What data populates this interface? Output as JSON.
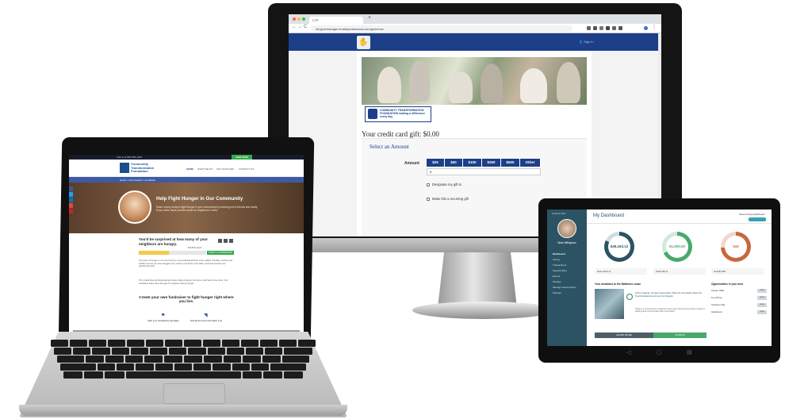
{
  "monitor": {
    "browser": {
      "tab_title": "CTF",
      "tab_plus": "+",
      "url": "ctf.givemanager.charityondemand.com/give/now",
      "back": "←",
      "forward": "→",
      "reload": "C"
    },
    "site": {
      "sign_in": "Sign In",
      "logo_text": "COMMUNITY TRANSFORMATION FOUNDATION making a difference every day",
      "gift_label": "Your credit card gift: $0.00",
      "select_amount": "Select an Amount",
      "amount_label": "Amount",
      "amounts": [
        "$25",
        "$50",
        "$100",
        "$250",
        "$500",
        "Other"
      ],
      "amount_input": "$",
      "designate": "Designate my gift to",
      "recurring": "Make this a recurring gift"
    }
  },
  "laptop": {
    "phone": "Call us at 800-555-1234",
    "donate_now": "GIVE NOW",
    "org_name": "Community Transformation Foundation",
    "nav": [
      "HOME",
      "WHAT WE DO",
      "GET INVOLVED",
      "CONTACT US"
    ],
    "breadcrumb": "Home > Get Involved > Fundraise",
    "hero_title": "Help Fight Hunger in Our Community",
    "hero_sub": "Raise money today to fight hunger in your community by reaching out to friends and family. Every dollar helps provide meals for neighbors in need.",
    "surprised": "You'd be surprised at how many of your neighbors are hungry.",
    "progress_fraction": 0.45,
    "progress_label": "$19,500 raised",
    "start_btn": "START A FUNDRAISER",
    "para1": "The issue of hunger in our community is more widespread than many realize. Families, seniors and children across our area struggle every week to put food on the table, and local pantries see growing demand.",
    "para2": "The United Way and local partners have made progress, but there is still work to be done. Your fundraiser helps close the gap for neighbors facing hunger.",
    "create": "Create your own fundraiser to fight hunger right where you live.",
    "step1": "Start your fundraising campaign",
    "step2": "Spread the word and watch it go"
  },
  "tablet": {
    "brand": "Product-WW",
    "user_name": "Brian Billingham",
    "side_items": [
      "Dashboard",
      "Giving",
      "Transactions",
      "Opportunities",
      "Events",
      "Pledges",
      "Manage Subscriptions",
      "Settings"
    ],
    "title": "My Dashboard",
    "toggle_label": "Show Giving Dashboard",
    "rings": [
      {
        "value": "$49,163.12",
        "color": "#2c5364"
      },
      {
        "value": "$1,500.00",
        "color": "#4aa86b"
      },
      {
        "value": "432",
        "color": "#c9673f"
      }
    ],
    "stat_boxes": [
      "Gave Since $",
      "Total Gifts $",
      "Goal $1,000"
    ],
    "news_section": "Your donations to the Baltimore cause",
    "news_title": "Action Ageing: Hunger Association Reports Increasing Need for Food Assistance Across Our Region",
    "news_body": "Today our local partners released a new report showing how donor support is helping feed more families than ever before.",
    "learn_more": "LEARN MORE",
    "donate": "DONATE",
    "table_title": "Opportunities in your area",
    "table_rows": [
      {
        "label": "Hunger Walk",
        "btn": "VIEW"
      },
      {
        "label": "Food Drive",
        "btn": "VIEW"
      },
      {
        "label": "Volunteer Day",
        "btn": "VIEW"
      },
      {
        "label": "Gala Event",
        "btn": "VIEW"
      }
    ]
  }
}
